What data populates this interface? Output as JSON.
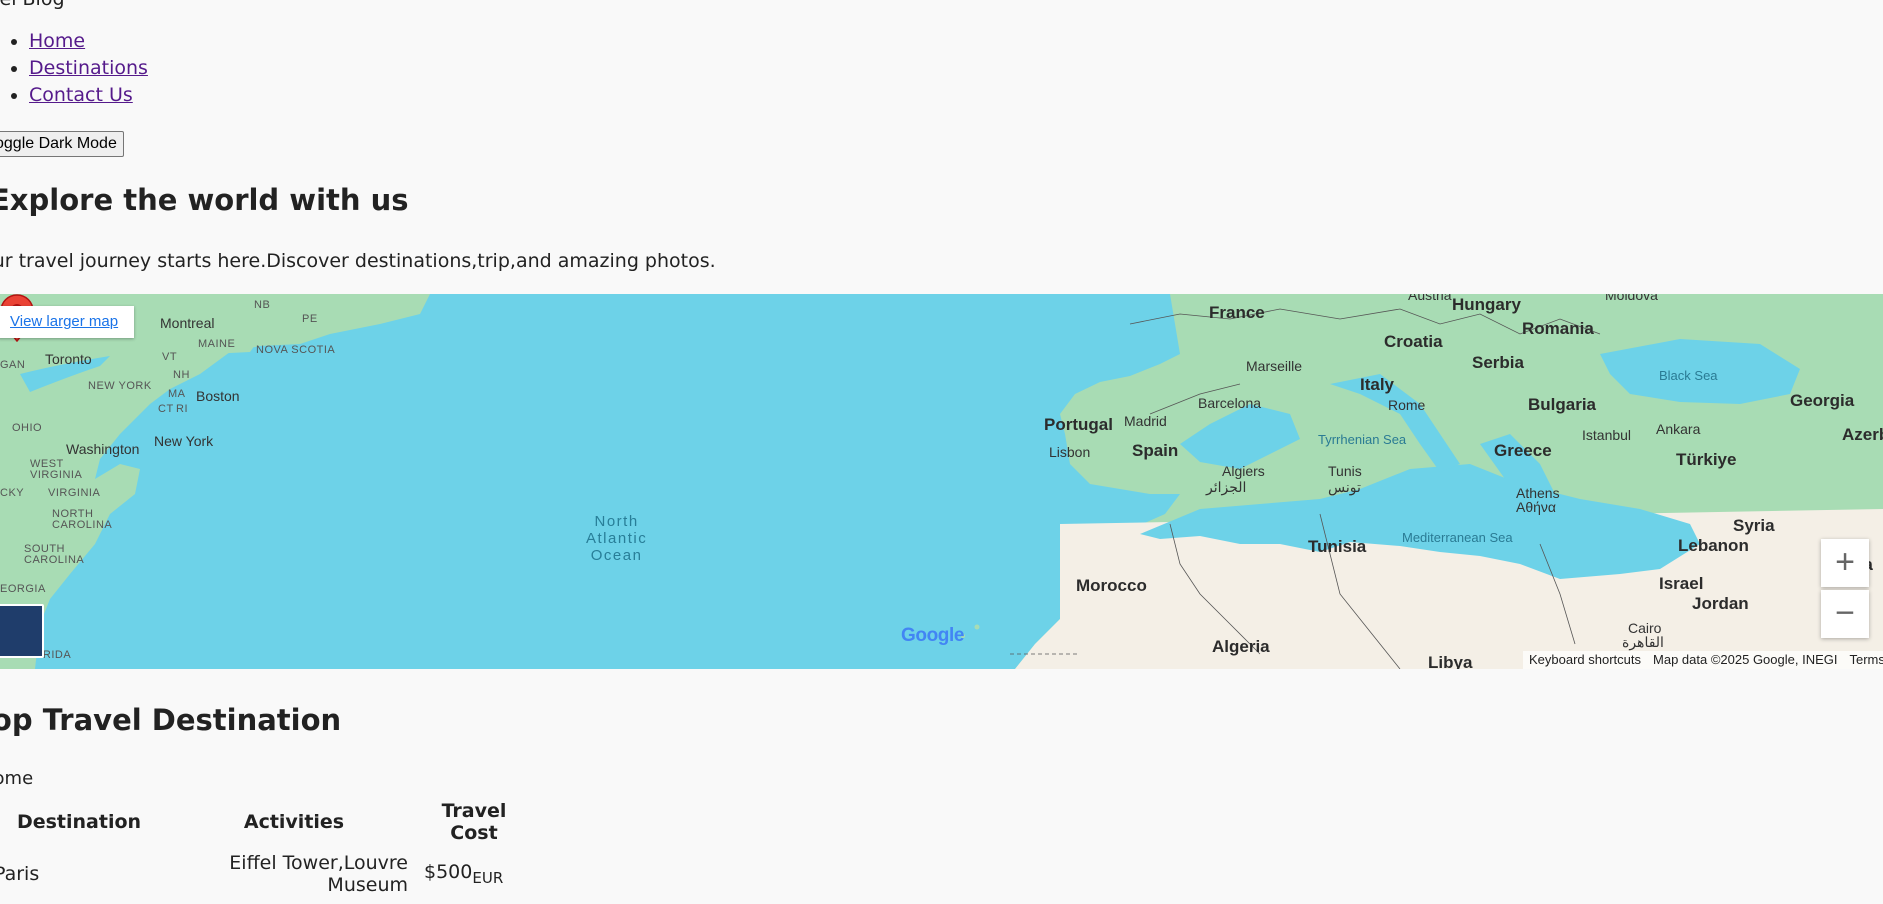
{
  "site": {
    "title": "Travel Blog"
  },
  "nav": {
    "items": [
      {
        "label": "Home"
      },
      {
        "label": "Destinations"
      },
      {
        "label": "Contact Us"
      }
    ]
  },
  "toggle_button": {
    "label": "Toggle Dark Mode"
  },
  "hero": {
    "title": "Explore the world with us",
    "text": "Your travel journey starts here.Discover destinations,trip,and amazing photos."
  },
  "map": {
    "larger_map_link": "View larger map",
    "zoom_in": "+",
    "zoom_out": "−",
    "logo": "Google",
    "footer": {
      "keyboard": "Keyboard shortcuts",
      "data": "Map data ©2025 Google, INEGI",
      "terms": "Terms"
    },
    "labels": {
      "france": "France",
      "hungary": "Hungary",
      "romania": "Romania",
      "croatia": "Croatia",
      "serbia": "Serbia",
      "marseille": "Marseille",
      "italy": "Italy",
      "rome": "Rome",
      "bulgaria": "Bulgaria",
      "portugal": "Portugal",
      "madrid": "Madrid",
      "barcelona": "Barcelona",
      "spain": "Spain",
      "lisbon": "Lisbon",
      "black_sea": "Black Sea",
      "georgia": "Georgia",
      "istanbul": "Istanbul",
      "ankara": "Ankara",
      "turkiye": "Türkiye",
      "azerbaijan": "Azerb",
      "tyrrhenian": "Tyrrhenian Sea",
      "algiers": "Algiers",
      "algiers_ar": "الجزائر",
      "tunis": "Tunis",
      "tunis_ar": "تونس",
      "greece": "Greece",
      "athens": "Athens",
      "athens_gr": "Αθήνα",
      "tunisia": "Tunisia",
      "mediterranean": "Mediterranean Sea",
      "syria": "Syria",
      "lebanon": "Lebanon",
      "iraq": "Ira",
      "israel": "Israel",
      "jordan": "Jordan",
      "morocco": "Morocco",
      "algeria": "Algeria",
      "libya": "Libya",
      "cairo": "Cairo",
      "cairo_ar": "القاهرة",
      "montreal": "Montreal",
      "toronto": "Toronto",
      "ny_state": "NEW YORK",
      "boston": "Boston",
      "new_york": "New York",
      "washington": "Washington",
      "maine": "MAINE",
      "nova_scotia": "NOVA SCOTIA",
      "nb": "NB",
      "pe": "PE",
      "vt": "VT",
      "nh": "NH",
      "ma": "MA",
      "ct": "CT",
      "ri": "RI",
      "ohio": "OHIO",
      "west_virginia": "WEST\nVIRGINIA",
      "kentucky": "CKY",
      "virginia": "VIRGINIA",
      "north_carolina": "NORTH\nCAROLINA",
      "south_carolina": "SOUTH\nCAROLINA",
      "georgia_us": "EORGIA",
      "florida": "FLORIDA",
      "michigan": "GAN",
      "austria": "Austria",
      "moldova": "Moldova",
      "north_atlantic": "North\nAtlantic\nOcean"
    }
  },
  "destinations": {
    "title": "Top Travel Destination",
    "caption": "Home",
    "headers": [
      "Destination",
      "Activities",
      "Travel Cost"
    ],
    "rows": [
      {
        "destination": "Paris",
        "activities": "Eiffel Tower,Louvre Museum",
        "cost": "$500",
        "unit": "EUR"
      }
    ]
  },
  "colors": {
    "link_visited": "#551a8b",
    "map_water": "#6dd2e8",
    "map_land": "#a8dcb4",
    "map_desert": "#f4efe6",
    "pin": "#ea4335"
  }
}
